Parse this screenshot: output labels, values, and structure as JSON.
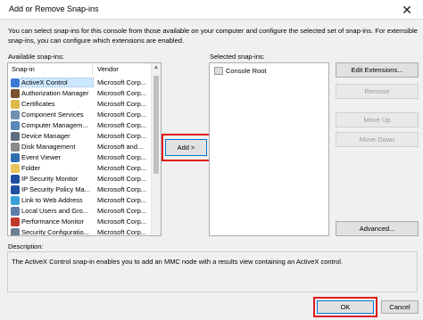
{
  "window": {
    "title": "Add or Remove Snap-ins",
    "close_glyph": "✕"
  },
  "intro": "You can select snap-ins for this console from those available on your computer and configure the selected set of snap-ins. For extensible snap-ins, you can configure which extensions are enabled.",
  "available": {
    "label": "Available snap-ins:",
    "columns": [
      "Snap-in",
      "Vendor"
    ],
    "items": [
      {
        "name": "ActiveX Control",
        "vendor": "Microsoft Corp...",
        "icon": "activex-icon",
        "color": "#3a7bd5"
      },
      {
        "name": "Authorization Manager",
        "vendor": "Microsoft Corp...",
        "icon": "authorization-icon",
        "color": "#7a5230"
      },
      {
        "name": "Certificates",
        "vendor": "Microsoft Corp...",
        "icon": "certificate-icon",
        "color": "#e0b84a"
      },
      {
        "name": "Component Services",
        "vendor": "Microsoft Corp...",
        "icon": "component-icon",
        "color": "#6f8fb3"
      },
      {
        "name": "Computer Managem...",
        "vendor": "Microsoft Corp...",
        "icon": "computer-icon",
        "color": "#5a86b8"
      },
      {
        "name": "Device Manager",
        "vendor": "Microsoft Corp...",
        "icon": "device-icon",
        "color": "#5e6e80"
      },
      {
        "name": "Disk Management",
        "vendor": "Microsoft and...",
        "icon": "disk-icon",
        "color": "#8a8a8a"
      },
      {
        "name": "Event Viewer",
        "vendor": "Microsoft Corp...",
        "icon": "event-icon",
        "color": "#2f6fb0"
      },
      {
        "name": "Folder",
        "vendor": "Microsoft Corp...",
        "icon": "folder-icon",
        "color": "#e8c35a"
      },
      {
        "name": "IP Security Monitor",
        "vendor": "Microsoft Corp...",
        "icon": "ipsec-monitor-icon",
        "color": "#1f4f9e"
      },
      {
        "name": "IP Security Policy Ma...",
        "vendor": "Microsoft Corp...",
        "icon": "ipsec-policy-icon",
        "color": "#1f4f9e"
      },
      {
        "name": "Link to Web Address",
        "vendor": "Microsoft Corp...",
        "icon": "web-link-icon",
        "color": "#3aa0d8"
      },
      {
        "name": "Local Users and Gro...",
        "vendor": "Microsoft Corp...",
        "icon": "users-icon",
        "color": "#5c7ea8"
      },
      {
        "name": "Performance Monitor",
        "vendor": "Microsoft Corp...",
        "icon": "performance-icon",
        "color": "#c0392b"
      },
      {
        "name": "Security Configuratio...",
        "vendor": "Microsoft Corp...",
        "icon": "security-config-icon",
        "color": "#6d7f93"
      }
    ]
  },
  "add_label": "Add >",
  "selected": {
    "label": "Selected snap-ins:",
    "root": "Console Root"
  },
  "buttons": {
    "edit_extensions": "Edit Extensions...",
    "remove": "Remove",
    "move_up": "Move Up",
    "move_down": "Move Down",
    "advanced": "Advanced..."
  },
  "description": {
    "label": "Description:",
    "text": "The ActiveX Control snap-in enables you to add an MMC node with a results view containing an ActiveX control."
  },
  "ok": "OK",
  "cancel": "Cancel",
  "colors": {
    "highlight_box": "#e01b1b",
    "focus_border": "#0078d7"
  }
}
